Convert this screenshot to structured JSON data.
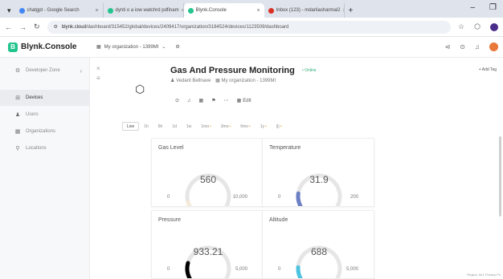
{
  "browser": {
    "tabs": [
      {
        "title": "chatgpt - Google Search",
        "color": "#4285f4",
        "active": false
      },
      {
        "title": "dynti o a iow watchrd pdfinam",
        "color": "#23c48e",
        "active": false
      },
      {
        "title": "Blynk.Console",
        "color": "#23c48e",
        "active": true
      },
      {
        "title": "Inbox (123) - mdarliasharmal2",
        "color": "#d93025",
        "active": false
      }
    ],
    "new_tab": "+",
    "tab_list": "▾",
    "window_controls": [
      "–",
      "❐"
    ],
    "url_host": "blynk.cloud",
    "url_path": "/dashboard/315452/global/devices/2409417/organization/3184524/devices/1123509/dashboard"
  },
  "header": {
    "brand": "Blynk.Console",
    "brand_initial": "B",
    "org_selector": "My organization - 1399MI"
  },
  "sidebar": {
    "items": [
      {
        "label": "Developer Zone",
        "icon": "⚙",
        "active": false,
        "chevron": true
      },
      {
        "label": "Devices",
        "icon": "⊞",
        "active": true,
        "chevron": false
      },
      {
        "label": "Users",
        "icon": "♟",
        "active": false,
        "chevron": false
      },
      {
        "label": "Organizations",
        "icon": "▦",
        "active": false,
        "chevron": false
      },
      {
        "label": "Locations",
        "icon": "⚲",
        "active": false,
        "chevron": false
      }
    ]
  },
  "device": {
    "title": "Gas And Pressure Monitoring",
    "status": "• Online",
    "owner": "Vedant Bellnave",
    "organization": "My organization - 1399MI",
    "edit_label": "Edit",
    "add_tag": "+ Add Tag"
  },
  "time_ranges": [
    {
      "label": "Live",
      "active": true,
      "pro": false
    },
    {
      "label": "1h",
      "active": false,
      "pro": false
    },
    {
      "label": "6h",
      "active": false,
      "pro": false
    },
    {
      "label": "1d",
      "active": false,
      "pro": false
    },
    {
      "label": "1w",
      "active": false,
      "pro": false
    },
    {
      "label": "1mo",
      "active": false,
      "pro": true
    },
    {
      "label": "3mo",
      "active": false,
      "pro": true
    },
    {
      "label": "6mo",
      "active": false,
      "pro": true
    },
    {
      "label": "1y",
      "active": false,
      "pro": true
    },
    {
      "label": "|||",
      "active": false,
      "pro": true
    }
  ],
  "widgets": [
    {
      "title": "Gas Level",
      "value": "560",
      "min": "0",
      "max": "10,000",
      "fraction": 0.056,
      "color": "#f6ead8"
    },
    {
      "title": "Temperature",
      "value": "31.9",
      "min": "0",
      "max": "200",
      "fraction": 0.16,
      "color": "#6b7fc4"
    },
    {
      "title": "Pressure",
      "value": "933.21",
      "min": "0",
      "max": "5,000",
      "fraction": 0.19,
      "color": "#000000"
    },
    {
      "title": "Altitude",
      "value": "688",
      "min": "0",
      "max": "5,000",
      "fraction": 0.14,
      "color": "#4ec3df"
    }
  ],
  "footer": "Region: blr1  Privacy Po"
}
